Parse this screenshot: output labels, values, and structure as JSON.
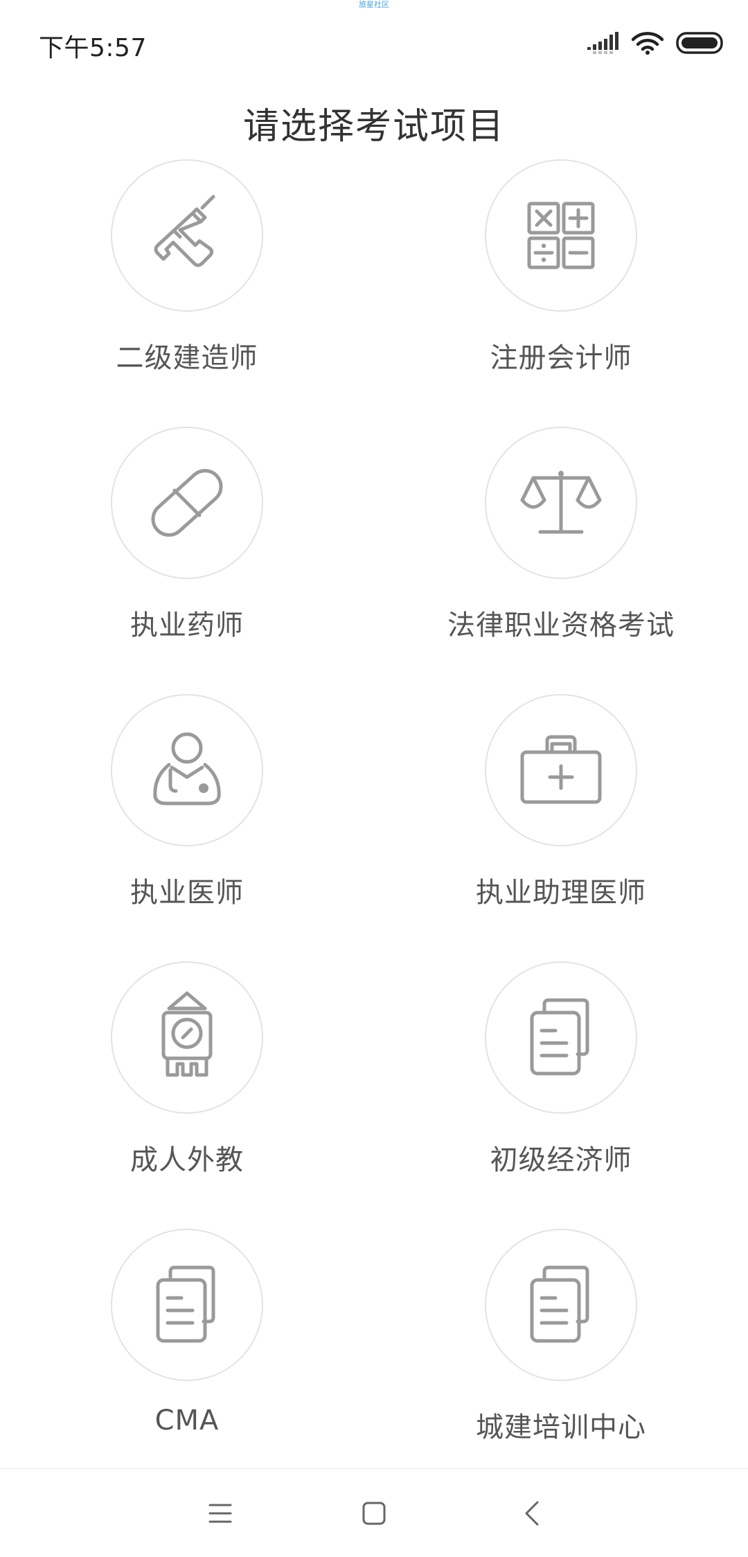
{
  "top_caption": "旅星社区",
  "status_bar": {
    "time": "下午5:57",
    "icons": [
      "signal-icon",
      "wifi-icon",
      "battery-icon"
    ]
  },
  "page_title": "请选择考试项目",
  "exam_items": [
    {
      "label": "二级建造师",
      "icon": "drill-icon"
    },
    {
      "label": "注册会计师",
      "icon": "calculator-icon"
    },
    {
      "label": "执业药师",
      "icon": "pill-icon"
    },
    {
      "label": "法律职业资格考试",
      "icon": "scales-icon"
    },
    {
      "label": "执业医师",
      "icon": "doctor-icon"
    },
    {
      "label": "执业助理医师",
      "icon": "medical-kit-icon"
    },
    {
      "label": "成人外教",
      "icon": "clock-tower-icon"
    },
    {
      "label": "初级经济师",
      "icon": "documents-icon"
    },
    {
      "label": "CMA",
      "icon": "documents-icon"
    },
    {
      "label": "城建培训中心",
      "icon": "documents-icon"
    }
  ],
  "nav_bar": {
    "icons": [
      "menu-icon",
      "home-icon",
      "back-icon"
    ]
  },
  "colors": {
    "icon_stroke": "#9a9a9a",
    "circle_border": "#e3e3e3",
    "label_text": "#555555",
    "title_text": "#333333"
  }
}
